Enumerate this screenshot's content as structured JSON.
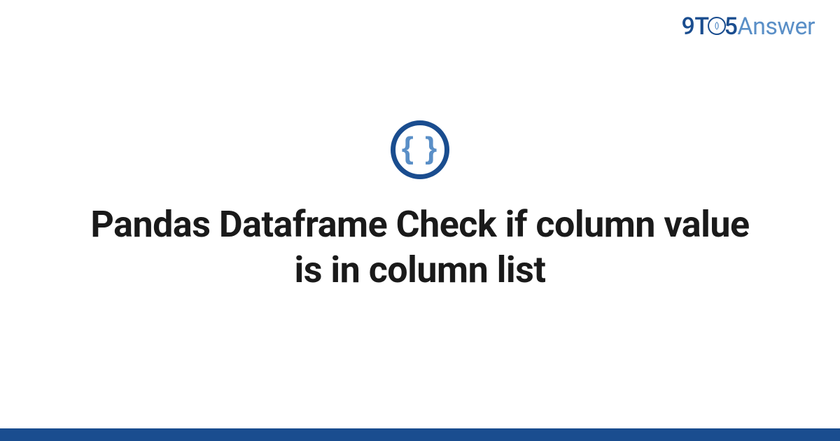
{
  "logo": {
    "part1": "9T",
    "part2": "5",
    "part3": "Answer"
  },
  "icon": {
    "braces": "{ }"
  },
  "title": "Pandas Dataframe Check if column value is in column list"
}
